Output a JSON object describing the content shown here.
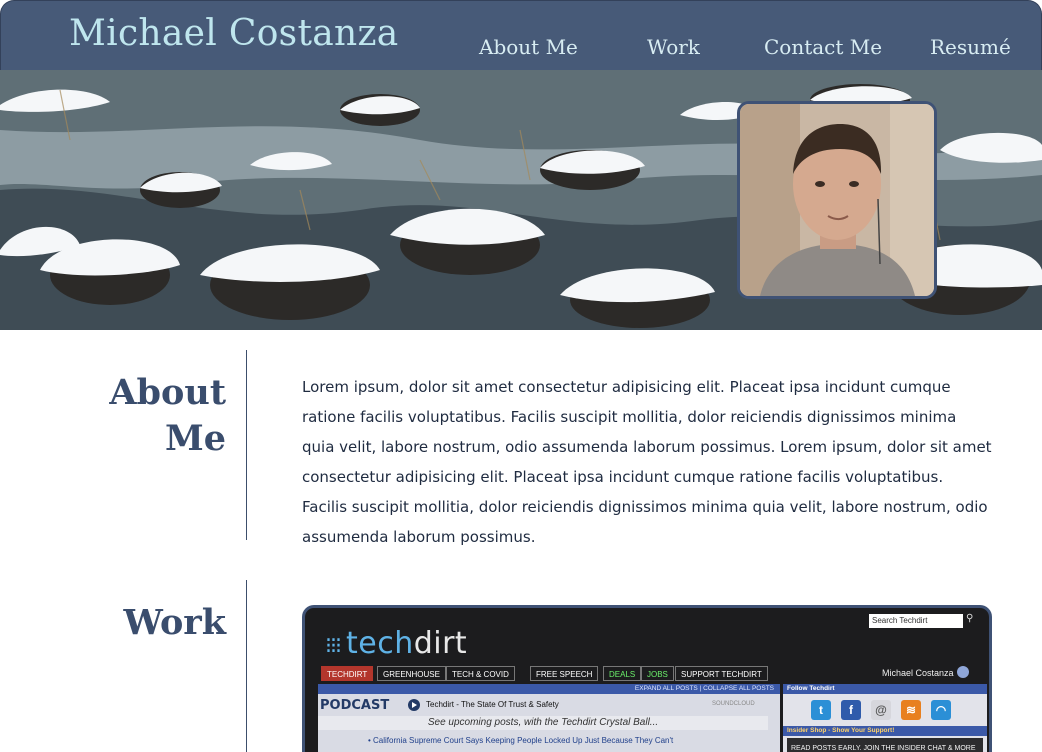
{
  "site": {
    "brand": "Michael Costanza",
    "nav": [
      "About Me",
      "Work",
      "Contact Me",
      "Resumé"
    ]
  },
  "about": {
    "title_line1": "About",
    "title_line2": "Me",
    "body": "Lorem ipsum, dolor sit amet consectetur adipisicing elit. Placeat ipsa incidunt cumque ratione facilis voluptatibus. Facilis suscipit mollitia, dolor reiciendis dignissimos minima quia velit, labore nostrum, odio assumenda laborum possimus. Lorem ipsum, dolor sit amet consectetur adipisicing elit. Placeat ipsa incidunt cumque ratione facilis voluptatibus. Facilis suscipit mollitia, dolor reiciendis dignissimos minima quia velit, labore nostrum, odio assumenda laborum possimus."
  },
  "work": {
    "title": "Work",
    "preview": {
      "logo_a": "tech",
      "logo_b": "dirt",
      "search_placeholder": "Search Techdirt",
      "tabs": [
        "TECHDIRT",
        "GREENHOUSE",
        "TECH & COVID",
        "FREE SPEECH",
        "DEALS",
        "JOBS",
        "SUPPORT TECHDIRT"
      ],
      "user": "Michael Costanza",
      "bar_text": "EXPAND ALL POSTS | COLLAPSE ALL POSTS",
      "podcast_label": "PODCAST",
      "podcast_title": "Techdirt - The State Of Trust & Safety",
      "soundcloud": "SOUNDCLOUD",
      "crystal_ball": "See upcoming posts, with the Techdirt Crystal Ball...",
      "headline": "• California Supreme Court Says Keeping People Locked Up Just Because They Can't",
      "follow": "Follow Techdirt",
      "shop": "Insider Shop - Show Your Support!",
      "shop_body": "READ POSTS EARLY. JOIN THE INSIDER CHAT & MORE"
    }
  },
  "icons": {
    "profile": "profile-photo",
    "search": "search-icon"
  }
}
